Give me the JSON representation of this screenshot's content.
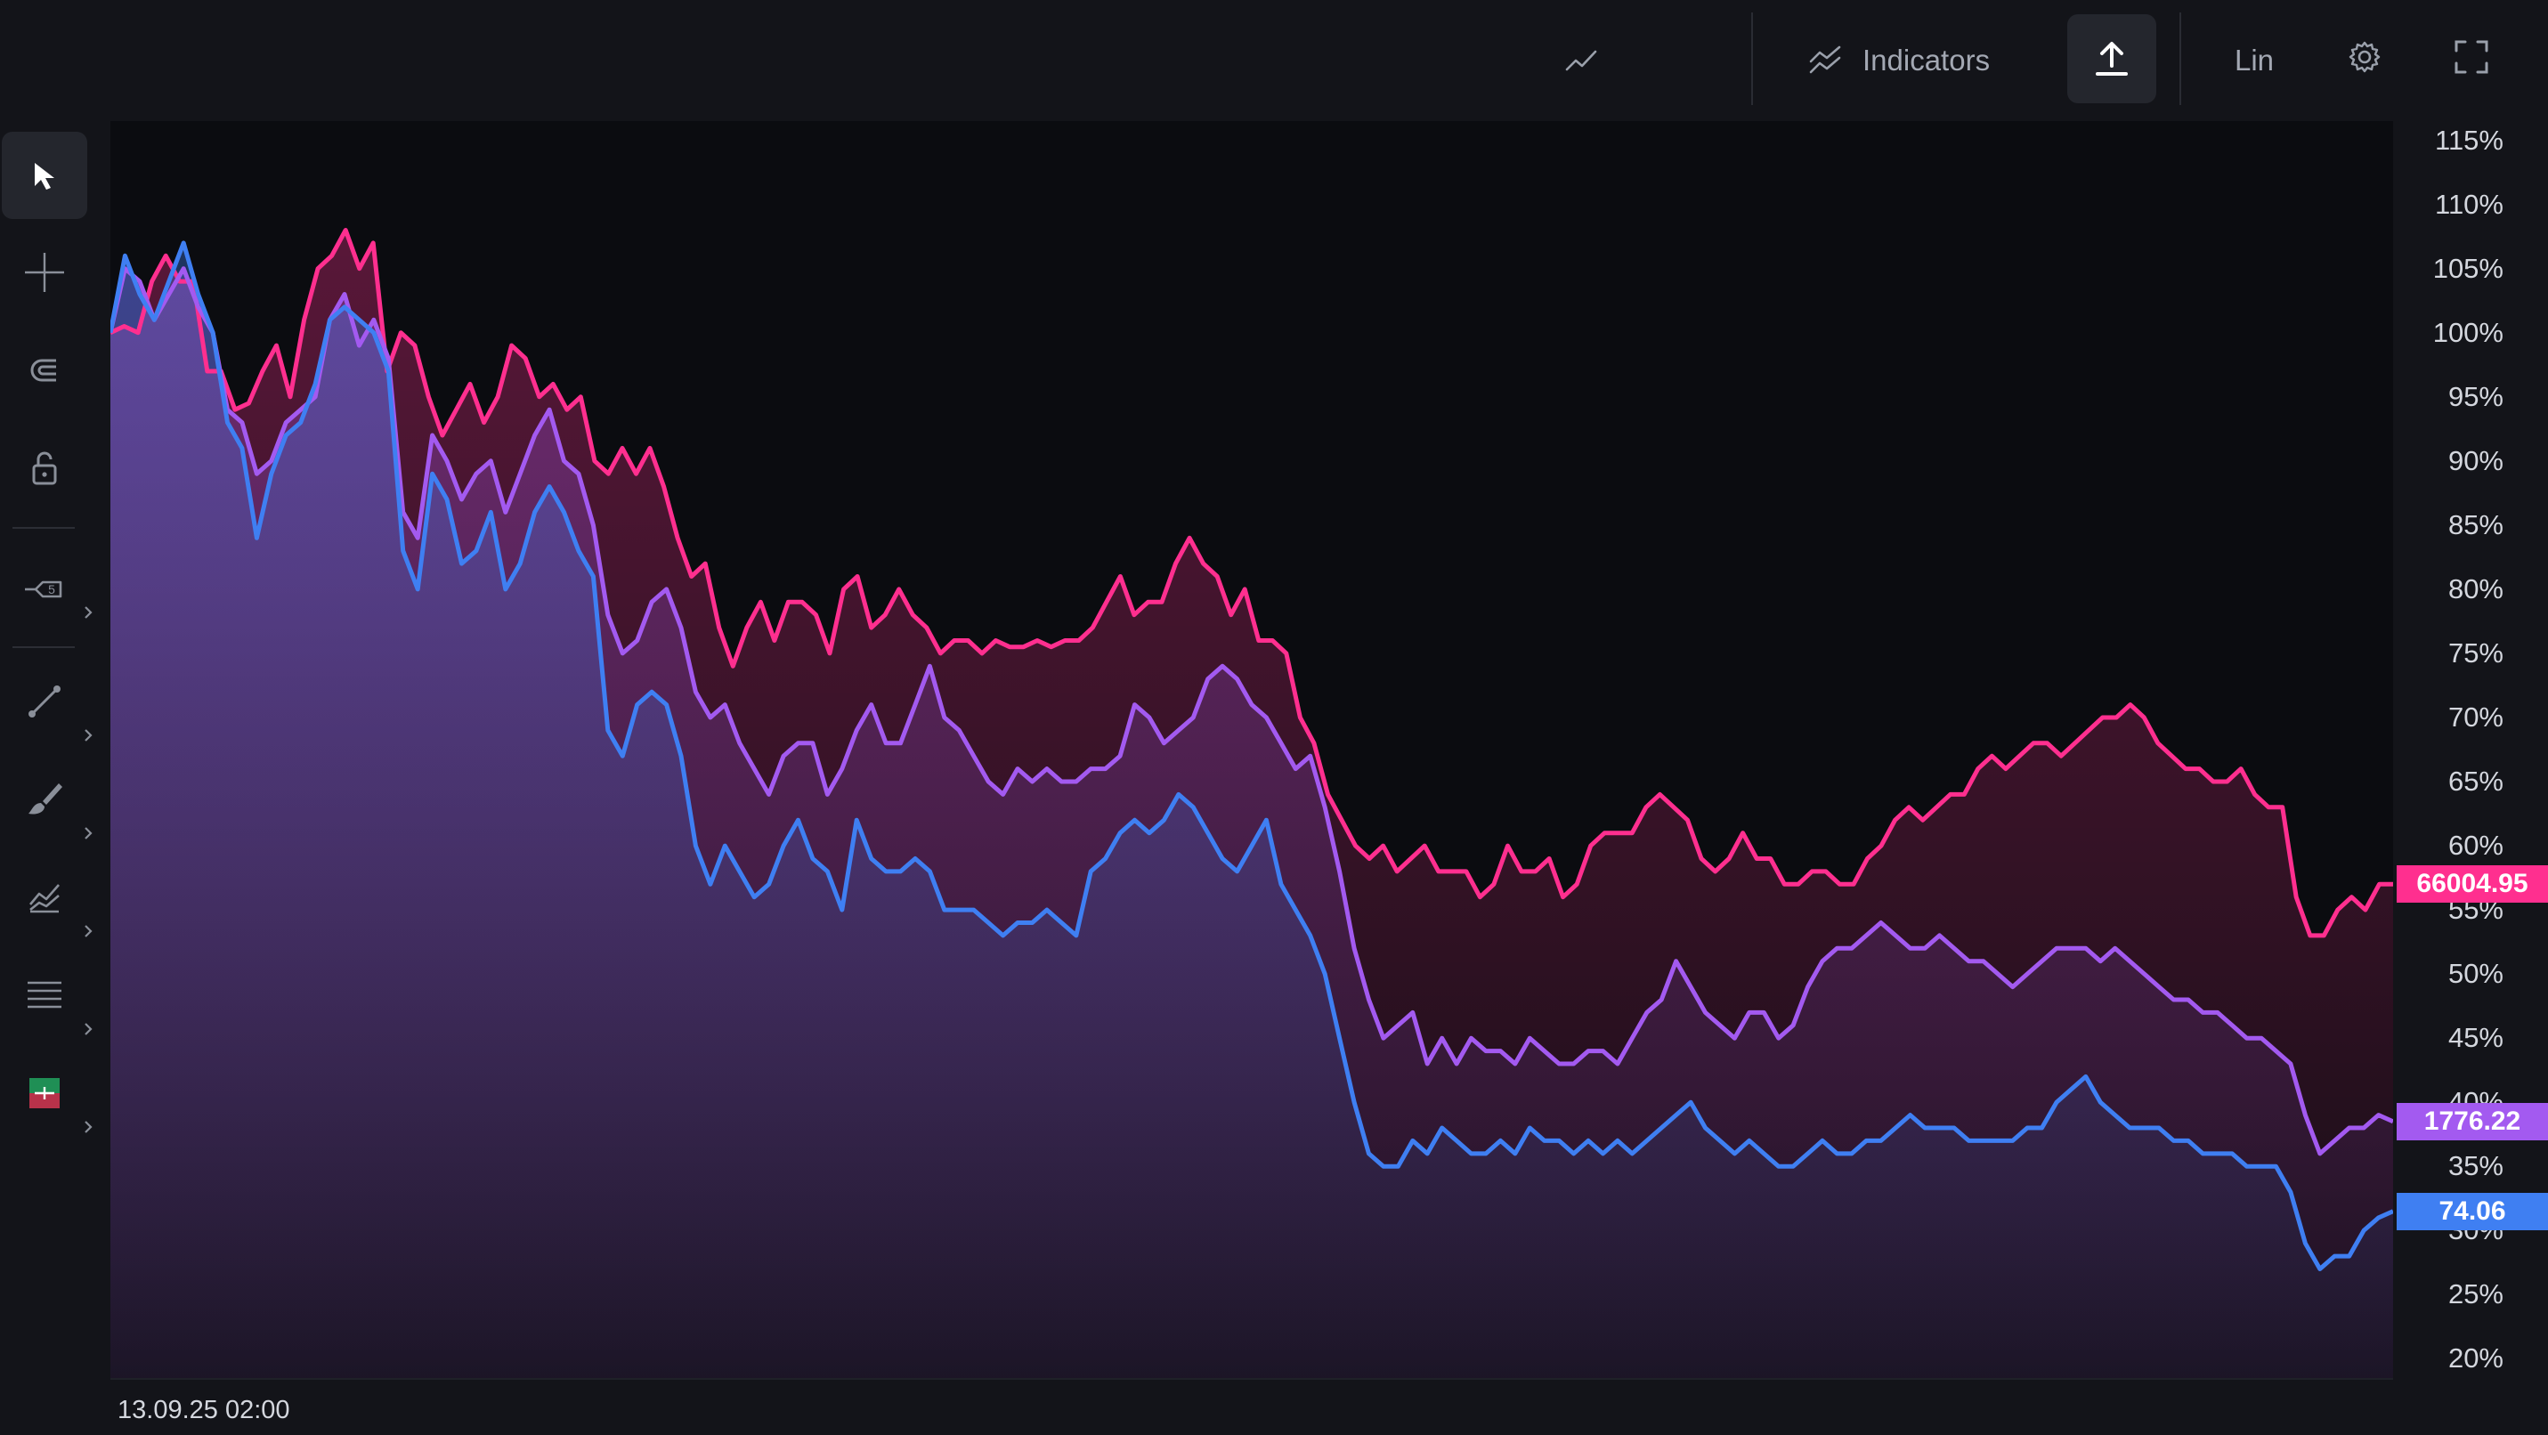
{
  "toolbar": {
    "chart_type_icon": "line-chart-icon",
    "indicators_label": "Indicators",
    "indicators_icon": "indicators-icon",
    "upload_icon": "upload-icon",
    "scale_label": "Lin",
    "settings_icon": "gear-icon",
    "fullscreen_icon": "fullscreen-icon"
  },
  "left_tools": [
    {
      "name": "cursor-tool",
      "icon": "cursor-icon",
      "active": true
    },
    {
      "name": "crosshair-tool",
      "icon": "crosshair-icon"
    },
    {
      "name": "magnet-tool",
      "icon": "magnet-icon"
    },
    {
      "name": "lock-tool",
      "icon": "lock-icon"
    },
    {
      "name": "measure-tool",
      "icon": "measure-icon"
    },
    {
      "name": "trend-line-tool",
      "icon": "trend-line-icon"
    },
    {
      "name": "brush-tool",
      "icon": "brush-icon"
    },
    {
      "name": "pattern-tool",
      "icon": "pattern-icon"
    },
    {
      "name": "fib-tool",
      "icon": "lines-icon"
    },
    {
      "name": "position-tool",
      "icon": "long-position-icon"
    }
  ],
  "colors": {
    "background": "#0b0c10",
    "series_pink": "#ff2f8f",
    "series_purple": "#a35af0",
    "series_blue": "#3f7ff2"
  },
  "chart_data": {
    "type": "area",
    "x_start_label": "13.09.25 02:00",
    "y_scale": "percent",
    "ylim": [
      18.5,
      116.5
    ],
    "y_ticks": [
      "115%",
      "110%",
      "105%",
      "100%",
      "95%",
      "90%",
      "85%",
      "80%",
      "75%",
      "70%",
      "65%",
      "60%",
      "55%",
      "50%",
      "45%",
      "40%",
      "35%",
      "30%",
      "25%",
      "20%"
    ],
    "series": [
      {
        "color": "#ff2f8f",
        "last_value_label": "66004.95",
        "last_percent": 57.0,
        "values": [
          100,
          100.5,
          100,
          104,
          106,
          104,
          104,
          97,
          97,
          94,
          94.5,
          97,
          99,
          95,
          101,
          105,
          106,
          108,
          105,
          107,
          97,
          100,
          99,
          95,
          92,
          94,
          96,
          93,
          95,
          99,
          98,
          95,
          96,
          94,
          95,
          90,
          89,
          91,
          89,
          91,
          88,
          84,
          81,
          82,
          77,
          74,
          77,
          79,
          76,
          79,
          79,
          78,
          75,
          80,
          81,
          77,
          78,
          80,
          78,
          77,
          75,
          76,
          76,
          75,
          76,
          75.5,
          75.5,
          76,
          75.5,
          76,
          76,
          77,
          79,
          81,
          78,
          79,
          79,
          82,
          84,
          82,
          81,
          78,
          80,
          76,
          76,
          75,
          70,
          68,
          64,
          62,
          60,
          59,
          60,
          58,
          59,
          60,
          58,
          58,
          58,
          56,
          57,
          60,
          58,
          58,
          59,
          56,
          57,
          60,
          61,
          61,
          61,
          63,
          64,
          63,
          62,
          59,
          58,
          59,
          61,
          59,
          59,
          57,
          57,
          58,
          58,
          57,
          57,
          59,
          60,
          62,
          63,
          62,
          63,
          64,
          64,
          66,
          67,
          66,
          67,
          68,
          68,
          67,
          68,
          69,
          70,
          70,
          71,
          70,
          68,
          67,
          66,
          66,
          65,
          65,
          66,
          64,
          63,
          63,
          56,
          53,
          53,
          55,
          56,
          55,
          57,
          57
        ]
      },
      {
        "color": "#a35af0",
        "last_value_label": "1776.22",
        "last_percent": 38.5,
        "values": [
          100,
          105,
          104,
          101,
          103,
          105,
          102,
          100,
          94,
          93,
          89,
          90,
          93,
          94,
          95,
          101,
          103,
          99,
          101,
          98,
          86,
          84,
          92,
          90,
          87,
          89,
          90,
          86,
          89,
          92,
          94,
          90,
          89,
          85,
          78,
          75,
          76,
          79,
          80,
          77,
          72,
          70,
          71,
          68,
          66,
          64,
          67,
          68,
          68,
          64,
          66,
          69,
          71,
          68,
          68,
          71,
          74,
          70,
          69,
          67,
          65,
          64,
          66,
          65,
          66,
          65,
          65,
          66,
          66,
          67,
          71,
          70,
          68,
          69,
          70,
          73,
          74,
          73,
          71,
          70,
          68,
          66,
          67,
          63,
          58,
          52,
          48,
          45,
          46,
          47,
          43,
          45,
          43,
          45,
          44,
          44,
          43,
          45,
          44,
          43,
          43,
          44,
          44,
          43,
          45,
          47,
          48,
          51,
          49,
          47,
          46,
          45,
          47,
          47,
          45,
          46,
          49,
          51,
          52,
          52,
          53,
          54,
          53,
          52,
          52,
          53,
          52,
          51,
          51,
          50,
          49,
          50,
          51,
          52,
          52,
          52,
          51,
          52,
          51,
          50,
          49,
          48,
          48,
          47,
          47,
          46,
          45,
          45,
          44,
          43,
          39,
          36,
          37,
          38,
          38,
          39,
          38.5
        ]
      },
      {
        "color": "#3f7ff2",
        "last_value_label": "74.06",
        "last_percent": 31.5,
        "values": [
          100,
          106,
          103,
          101,
          104,
          107,
          103,
          100,
          93,
          91,
          84,
          89,
          92,
          93,
          96,
          101,
          102,
          101,
          100,
          97,
          83,
          80,
          89,
          87,
          82,
          83,
          86,
          80,
          82,
          86,
          88,
          86,
          83,
          81,
          69,
          67,
          71,
          72,
          71,
          67,
          60,
          57,
          60,
          58,
          56,
          57,
          60,
          62,
          59,
          58,
          55,
          62,
          59,
          58,
          58,
          59,
          58,
          55,
          55,
          55,
          54,
          53,
          54,
          54,
          55,
          54,
          53,
          58,
          59,
          61,
          62,
          61,
          62,
          64,
          63,
          61,
          59,
          58,
          60,
          62,
          57,
          55,
          53,
          50,
          45,
          40,
          36,
          35,
          35,
          37,
          36,
          38,
          37,
          36,
          36,
          37,
          36,
          38,
          37,
          37,
          36,
          37,
          36,
          37,
          36,
          37,
          38,
          39,
          40,
          38,
          37,
          36,
          37,
          36,
          35,
          35,
          36,
          37,
          36,
          36,
          37,
          37,
          38,
          39,
          38,
          38,
          38,
          37,
          37,
          37,
          37,
          38,
          38,
          40,
          41,
          42,
          40,
          39,
          38,
          38,
          38,
          37,
          37,
          36,
          36,
          36,
          35,
          35,
          35,
          33,
          29,
          27,
          28,
          28,
          30,
          31,
          31.5
        ]
      }
    ]
  }
}
